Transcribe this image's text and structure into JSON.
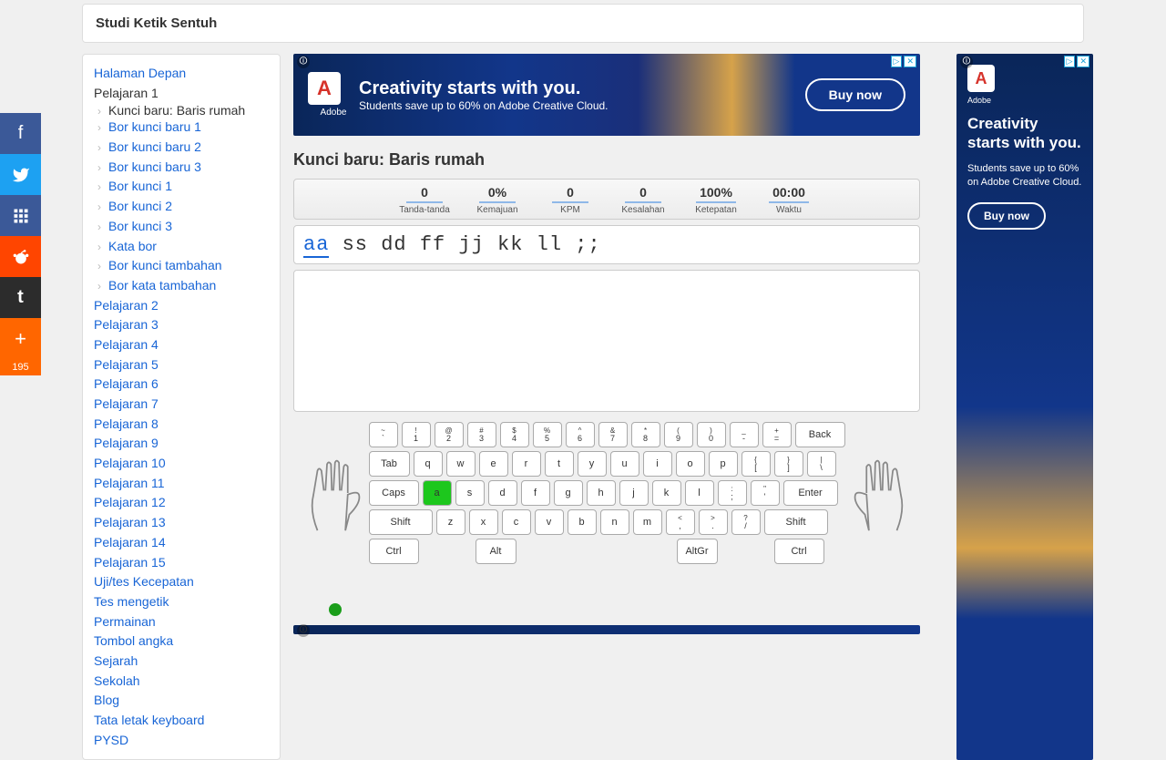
{
  "header": {
    "title": "Studi Ketik Sentuh"
  },
  "share": {
    "count": "195"
  },
  "sidebar": {
    "home": "Halaman Depan",
    "current_lesson": "Pelajaran 1",
    "subs": [
      {
        "label": "Kunci baru: Baris rumah",
        "current": true
      },
      {
        "label": "Bor kunci baru 1"
      },
      {
        "label": "Bor kunci baru 2"
      },
      {
        "label": "Bor kunci baru 3"
      },
      {
        "label": "Bor kunci 1"
      },
      {
        "label": "Bor kunci 2"
      },
      {
        "label": "Bor kunci 3"
      },
      {
        "label": "Kata bor"
      },
      {
        "label": "Bor kunci tambahan"
      },
      {
        "label": "Bor kata tambahan"
      }
    ],
    "lessons": [
      "Pelajaran 2",
      "Pelajaran 3",
      "Pelajaran 4",
      "Pelajaran 5",
      "Pelajaran 6",
      "Pelajaran 7",
      "Pelajaran 8",
      "Pelajaran 9",
      "Pelajaran 10",
      "Pelajaran 11",
      "Pelajaran 12",
      "Pelajaran 13",
      "Pelajaran 14",
      "Pelajaran 15"
    ],
    "extras": [
      "Uji/tes Kecepatan",
      "Tes mengetik",
      "Permainan",
      "Tombol angka",
      "Sejarah",
      "Sekolah",
      "Blog",
      "Tata letak keyboard",
      "PYSD"
    ]
  },
  "ad_top": {
    "logo": "A",
    "brand": "Adobe",
    "line1": "Creativity starts with you.",
    "line2": "Students save up to 60% on Adobe Creative Cloud.",
    "cta": "Buy now"
  },
  "lesson_title": "Kunci baru: Baris rumah",
  "stats": [
    {
      "v": "0",
      "l": "Tanda-tanda"
    },
    {
      "v": "0%",
      "l": "Kemajuan"
    },
    {
      "v": "0",
      "l": "KPM"
    },
    {
      "v": "0",
      "l": "Kesalahan"
    },
    {
      "v": "100%",
      "l": "Ketepatan"
    },
    {
      "v": "00:00",
      "l": "Waktu"
    }
  ],
  "typing": {
    "highlight": "aa",
    "rest": " ss dd ff jj kk ll ;;"
  },
  "keyboard": {
    "row1": [
      [
        "~",
        "`"
      ],
      [
        "!",
        "1"
      ],
      [
        "@",
        "2"
      ],
      [
        "#",
        "3"
      ],
      [
        "$",
        "4"
      ],
      [
        "%",
        "5"
      ],
      [
        "^",
        "6"
      ],
      [
        "&",
        "7"
      ],
      [
        "*",
        "8"
      ],
      [
        "(",
        "9"
      ],
      [
        ")",
        "0"
      ],
      [
        "_",
        "-"
      ],
      [
        "+",
        "="
      ]
    ],
    "back": "Back",
    "tab": "Tab",
    "row2": [
      "q",
      "w",
      "e",
      "r",
      "t",
      "y",
      "u",
      "i",
      "o",
      "p"
    ],
    "row2b": [
      [
        "{",
        "["
      ],
      [
        "}",
        "]"
      ],
      [
        "|",
        "\\"
      ]
    ],
    "caps": "Caps",
    "row3": [
      "a",
      "s",
      "d",
      "f",
      "g",
      "h",
      "j",
      "k",
      "l"
    ],
    "row3b": [
      [
        ":",
        ";"
      ],
      [
        "\"",
        "'"
      ]
    ],
    "enter": "Enter",
    "shift": "Shift",
    "row4": [
      "z",
      "x",
      "c",
      "v",
      "b",
      "n",
      "m"
    ],
    "row4b": [
      [
        "<",
        ","
      ],
      [
        ">",
        "."
      ],
      [
        "?",
        "/"
      ]
    ],
    "ctrl": "Ctrl",
    "alt": "Alt",
    "altgr": "AltGr"
  },
  "ad_right": {
    "logo": "A",
    "brand": "Adobe",
    "line1": "Creativity starts with you.",
    "line2": "Students save up to 60% on Adobe Creative Cloud.",
    "cta": "Buy now"
  }
}
